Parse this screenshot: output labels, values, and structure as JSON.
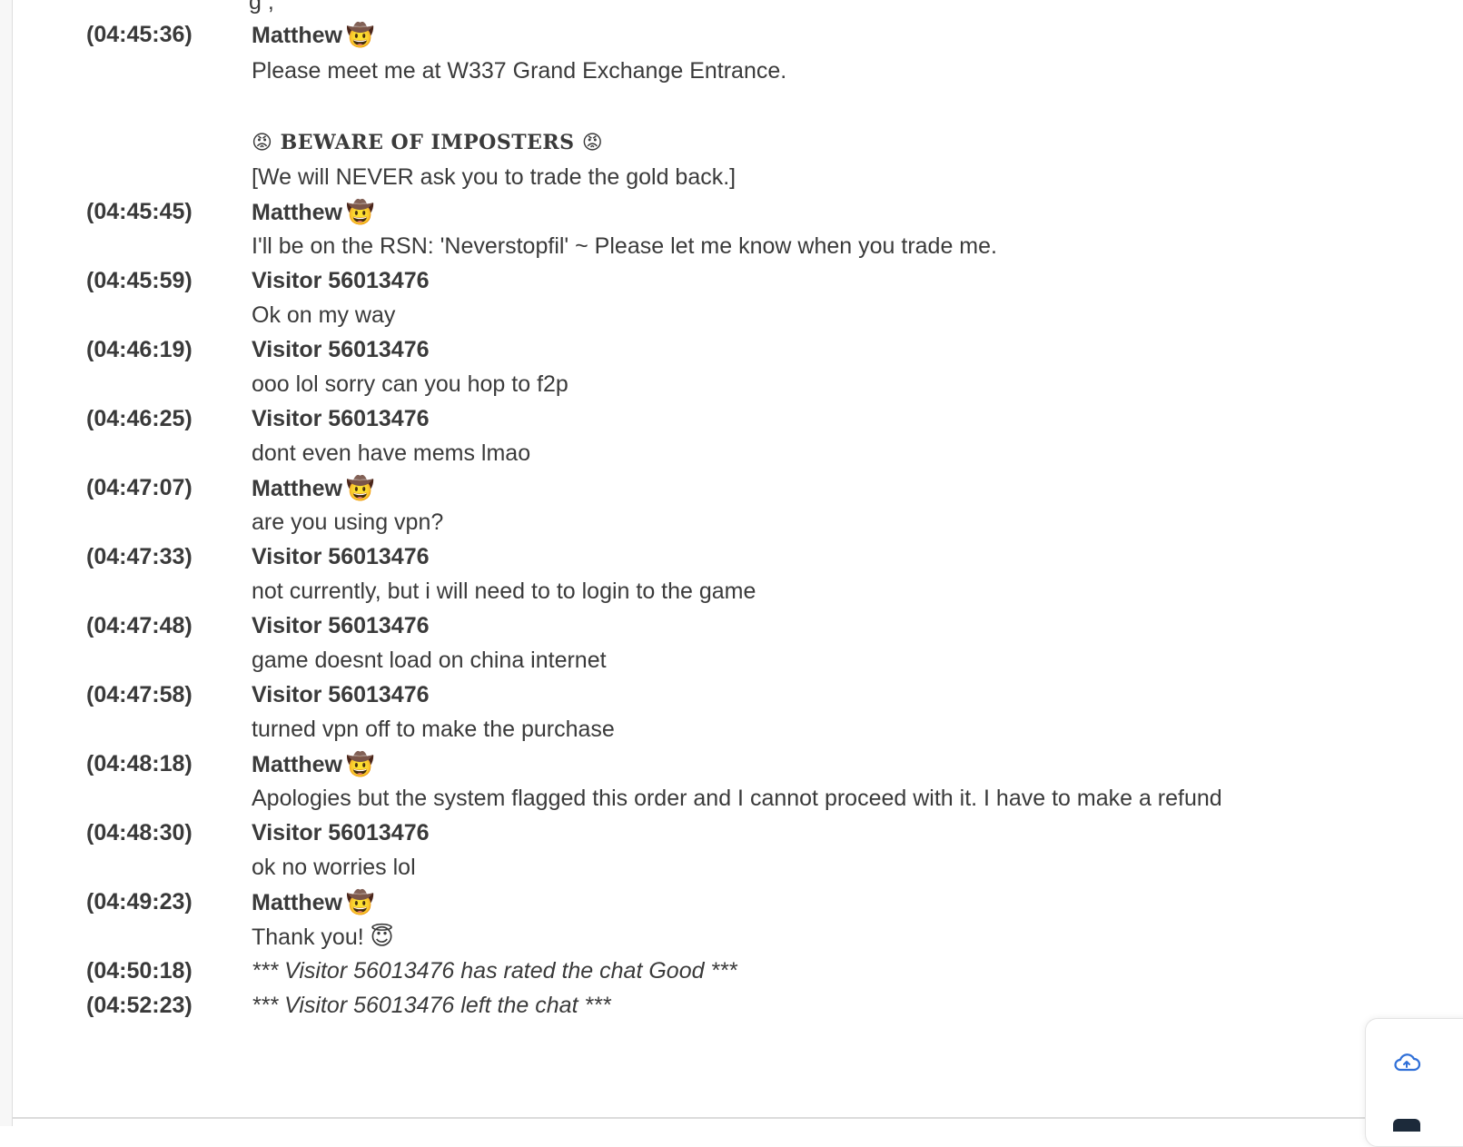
{
  "clipped_top_text": "g                    ,",
  "beware": {
    "emoji": "😡",
    "text": "BEWARE OF IMPOSTERS"
  },
  "messages": [
    {
      "time": "(04:45:36)",
      "author": "Matthew",
      "emoji": "🤠",
      "lines": [
        "Please meet me at W337 Grand Exchange Entrance."
      ]
    },
    {
      "time": "",
      "author": "",
      "emoji": "",
      "lines": [
        "[We will NEVER ask you to trade the gold back.]"
      ]
    },
    {
      "time": "(04:45:45)",
      "author": "Matthew",
      "emoji": "🤠",
      "lines": [
        "I'll be on the RSN: 'Neverstopfil' ~ Please let me know when you trade me."
      ]
    },
    {
      "time": "(04:45:59)",
      "author": "Visitor 56013476",
      "emoji": "",
      "lines": [
        "Ok on my way"
      ]
    },
    {
      "time": "(04:46:19)",
      "author": "Visitor 56013476",
      "emoji": "",
      "lines": [
        "ooo lol sorry can you hop to f2p"
      ]
    },
    {
      "time": "(04:46:25)",
      "author": "Visitor 56013476",
      "emoji": "",
      "lines": [
        "dont even have mems lmao"
      ]
    },
    {
      "time": "(04:47:07)",
      "author": "Matthew",
      "emoji": "🤠",
      "lines": [
        "are you using vpn?"
      ]
    },
    {
      "time": "(04:47:33)",
      "author": "Visitor 56013476",
      "emoji": "",
      "lines": [
        "not currently, but i will need to to login to the game"
      ]
    },
    {
      "time": "(04:47:48)",
      "author": "Visitor 56013476",
      "emoji": "",
      "lines": [
        "game doesnt load on china internet"
      ]
    },
    {
      "time": "(04:47:58)",
      "author": "Visitor 56013476",
      "emoji": "",
      "lines": [
        "turned vpn off to make the purchase"
      ]
    },
    {
      "time": "(04:48:18)",
      "author": "Matthew",
      "emoji": "🤠",
      "lines": [
        "Apologies but the system flagged this order and I cannot proceed with it. I have to make a refund"
      ]
    },
    {
      "time": "(04:48:30)",
      "author": "Visitor 56013476",
      "emoji": "",
      "lines": [
        "ok no worries lol"
      ]
    },
    {
      "time": "(04:49:23)",
      "author": "Matthew",
      "emoji": "🤠",
      "lines": [
        "Thank you! 😇"
      ]
    }
  ],
  "system_events": [
    {
      "time": "(04:50:18)",
      "text": "*** Visitor 56013476 has rated the chat Good ***"
    },
    {
      "time": "(04:52:23)",
      "text": "*** Visitor 56013476 left the chat ***"
    }
  ],
  "widget": {
    "cloud_icon": "cloud-sync-icon",
    "accent": "#2f6fd8"
  }
}
